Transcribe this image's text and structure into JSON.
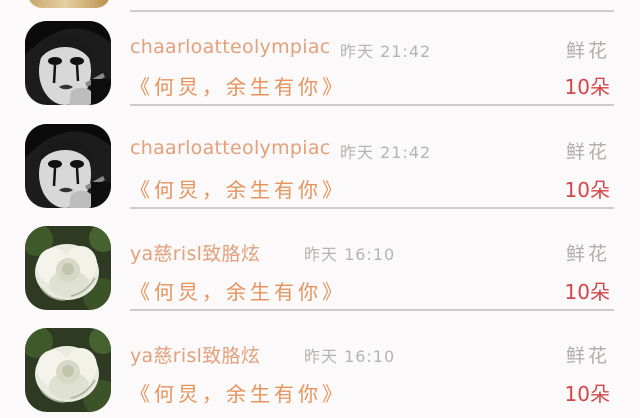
{
  "items": [
    {
      "avatar_icon": "mime-face-avatar",
      "name": "chaarloatteolympiac",
      "time": "昨天 21:42",
      "gift_type": "鲜花",
      "message": "《何炅，余生有你》",
      "count": "10朵"
    },
    {
      "avatar_icon": "mime-face-avatar",
      "name": "chaarloatteolympiac",
      "time": "昨天 21:42",
      "gift_type": "鲜花",
      "message": "《何炅，余生有你》",
      "count": "10朵"
    },
    {
      "avatar_icon": "white-rose-avatar",
      "name": "ya慈risl致胳炫",
      "time": "昨天 16:10",
      "gift_type": "鲜花",
      "message": "《何炅，余生有你》",
      "count": "10朵"
    },
    {
      "avatar_icon": "white-rose-avatar",
      "name": "ya慈risl致胳炫",
      "time": "昨天 16:10",
      "gift_type": "鲜花",
      "message": "《何炅，余生有你》",
      "count": "10朵"
    }
  ]
}
